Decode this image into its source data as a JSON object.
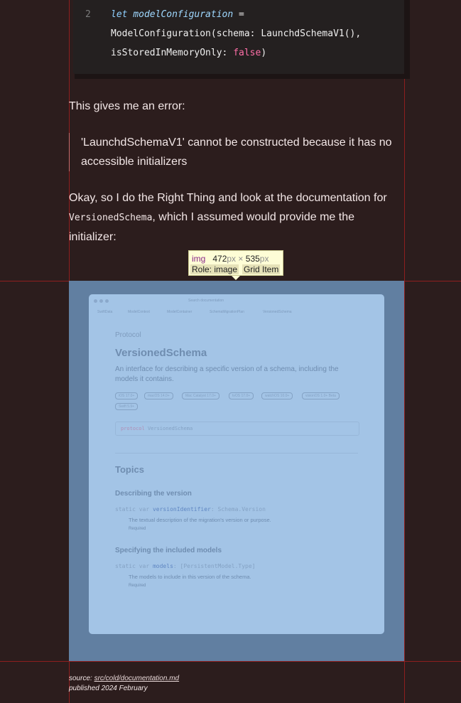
{
  "code": {
    "line_number": "2",
    "line1_keyword": "let",
    "line1_ident": "modelConfiguration",
    "line1_rest": " =",
    "line2": "ModelConfiguration(schema: LaunchdSchemaV1(),",
    "line3_pre": "isStoredInMemoryOnly: ",
    "line3_bool": "false",
    "line3_post": ")"
  },
  "content": {
    "para1": "This gives me an error:",
    "quote": "'LaunchdSchemaV1' cannot be constructed because it has no accessible initializers",
    "para2_pre": "Okay, so I do the Right Thing and look at the documentation for ",
    "para2_code": "VersionedSchema",
    "para2_post": ", which I assumed would provide me the initializer:"
  },
  "inspector": {
    "tag": "img",
    "width": "472",
    "height": "535",
    "unit": "px",
    "times": "×",
    "role": "Role: image",
    "grid_item": "Grid Item"
  },
  "doc": {
    "search_placeholder": "Search documentation",
    "breadcrumbs": [
      "SwiftData",
      "ModelContext",
      "ModelContainer",
      "SchemaMigrationPlan",
      "VersionedSchema"
    ],
    "kicker": "Protocol",
    "title": "VersionedSchema",
    "description": "An interface for describing a specific version of a schema, including the models it contains.",
    "badges": [
      "iOS 17.0+",
      "macOS 14.0+",
      "Mac Catalyst 17.0+",
      "tvOS 17.0+",
      "watchOS 10.0+",
      "visionOS 1.0+ Beta",
      "Swift 5.9+"
    ],
    "declaration_keyword": "protocol",
    "declaration_name": "VersionedSchema",
    "topics": "Topics",
    "section1": "Describing the version",
    "sig1_pre": "static var ",
    "sig1_name": "versionIdentifier",
    "sig1_post": ": Schema.Version",
    "sig1_desc": "The textual description of the migration's version or purpose.",
    "sig1_req": "Required",
    "section2": "Specifying the included models",
    "sig2_pre": "static var ",
    "sig2_name": "models",
    "sig2_post": ": [PersistentModel.Type]",
    "sig2_desc": "The models to include in this version of the schema.",
    "sig2_req": "Required"
  },
  "footer": {
    "source_label": "source: ",
    "source_link": "src/cold/documentation.md",
    "published": "published 2024 February"
  },
  "colors": {
    "background": "#2c1d1d",
    "guide": "#8e1f1f",
    "highlight": "#617fa1"
  }
}
